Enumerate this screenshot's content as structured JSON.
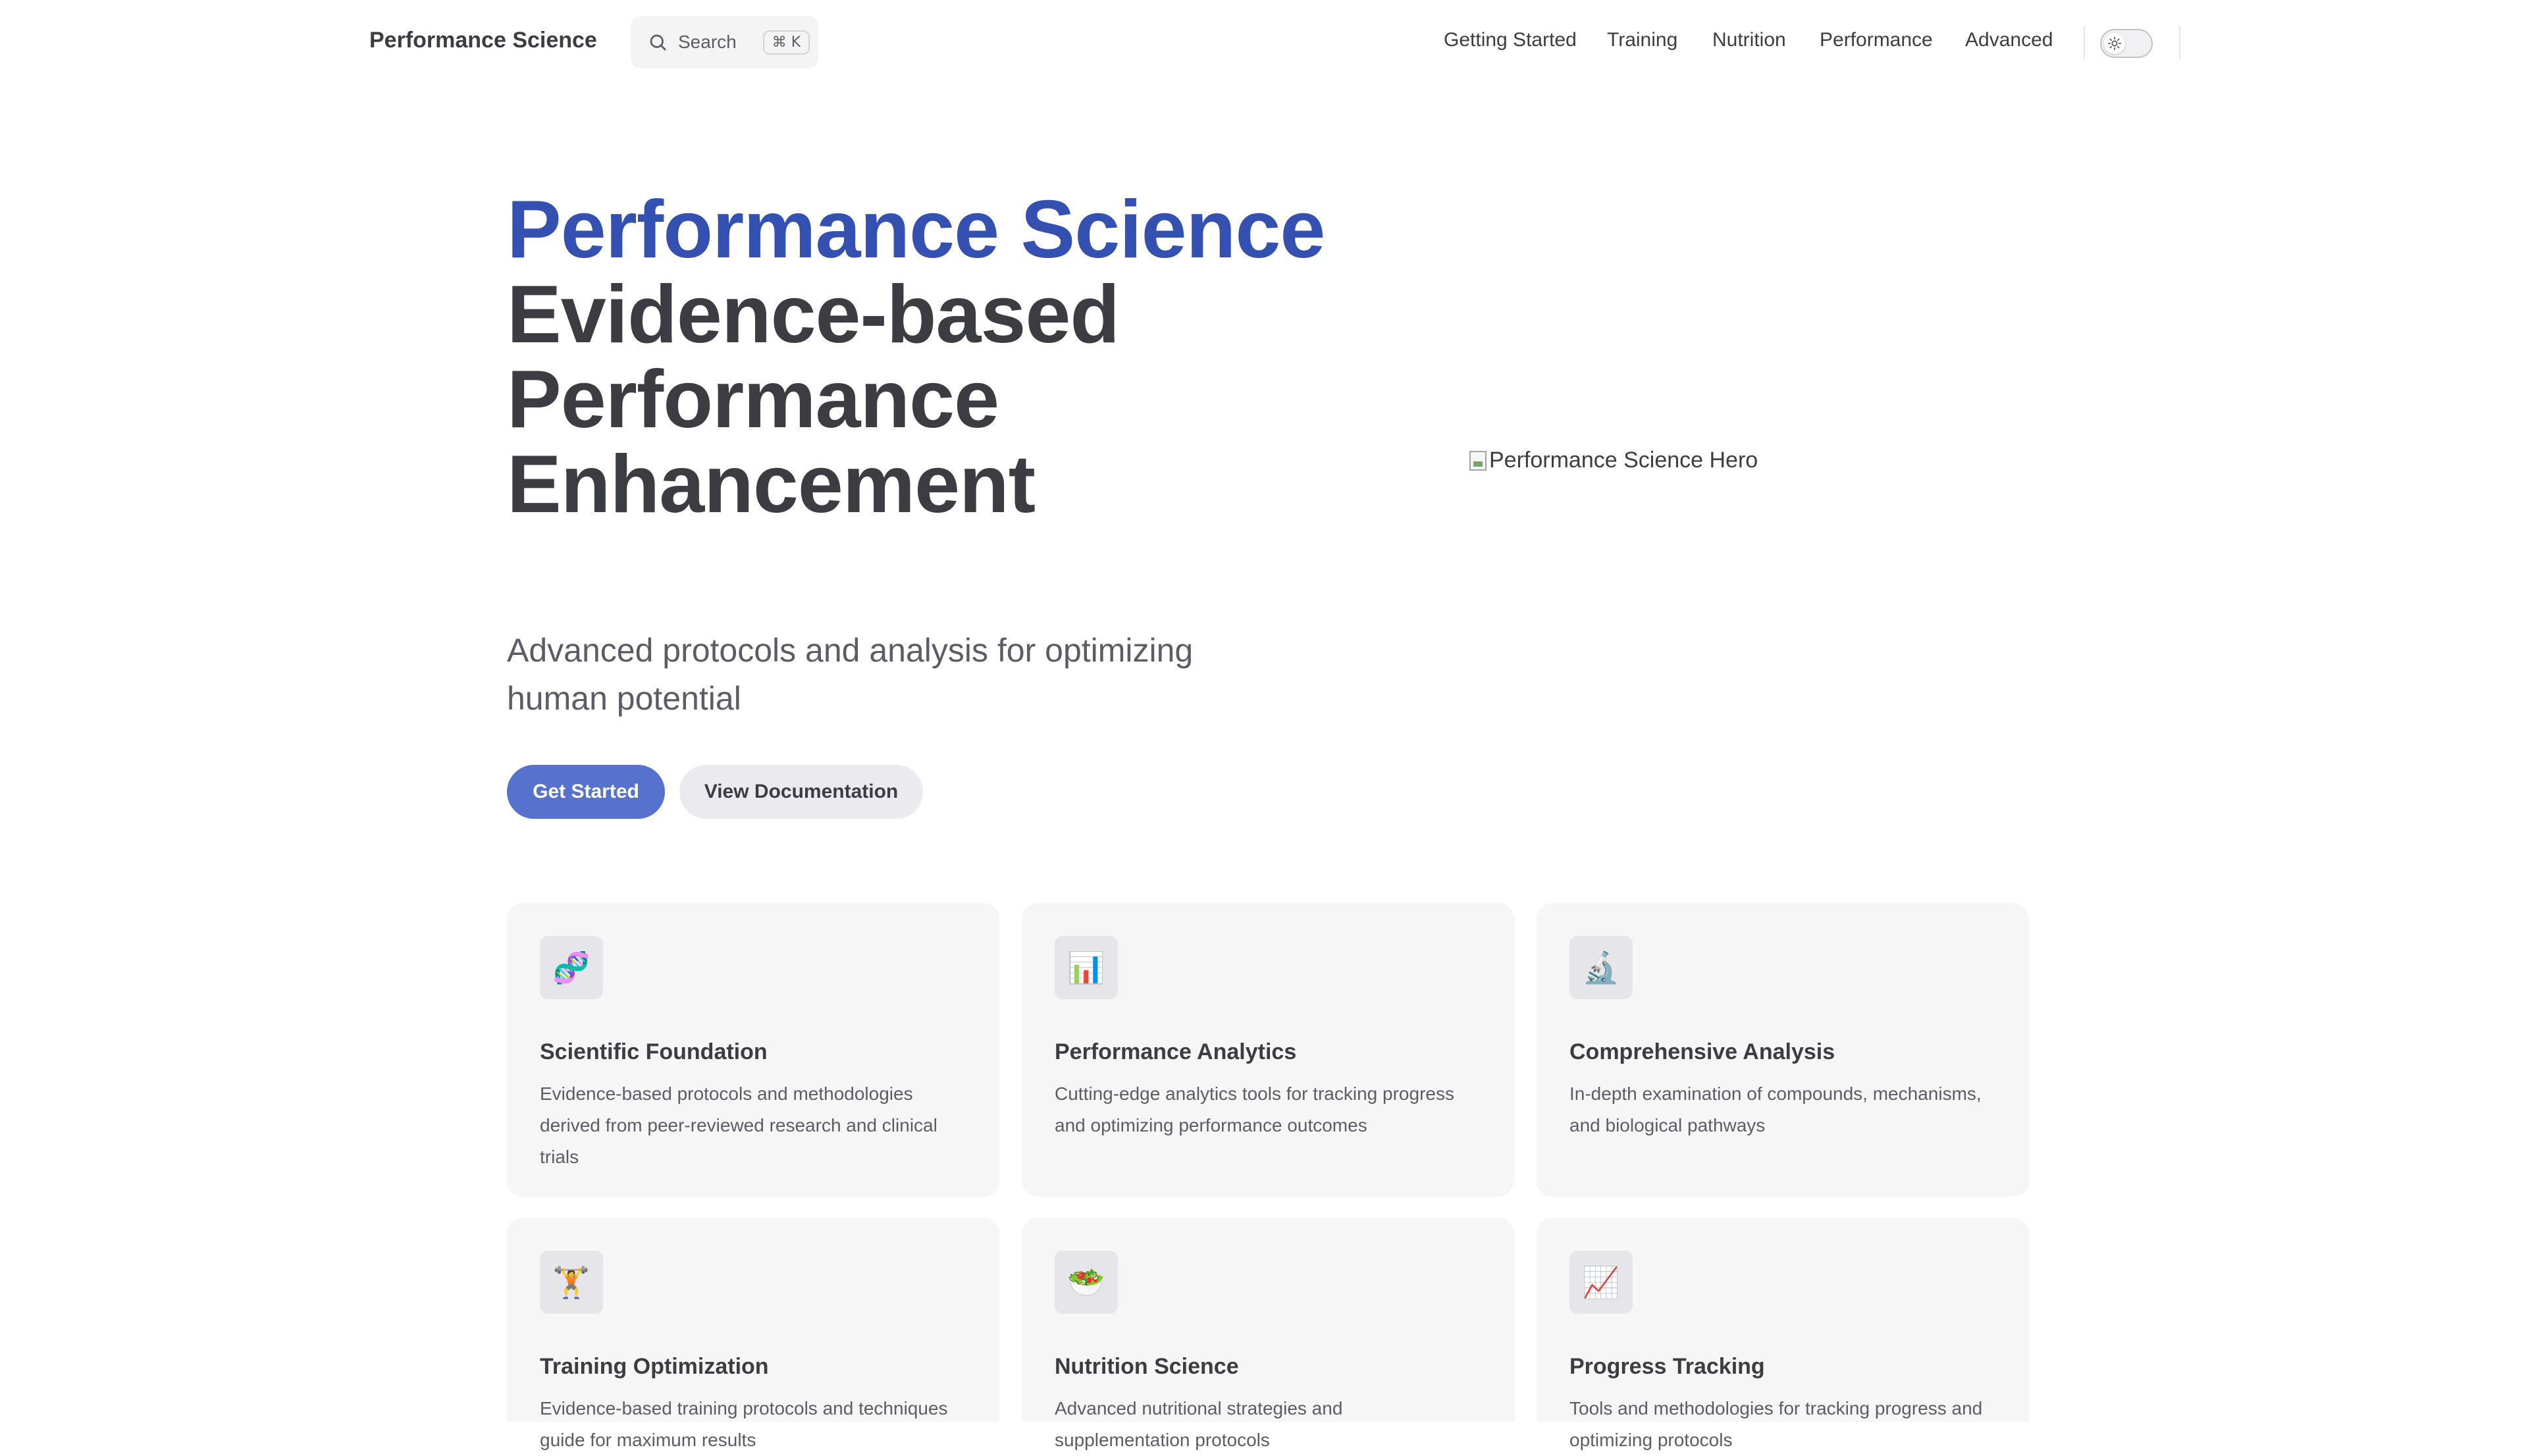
{
  "nav": {
    "brand": "Performance Science",
    "search": {
      "label": "Search",
      "shortcut": "⌘ K"
    },
    "links": [
      "Getting Started",
      "Training",
      "Nutrition",
      "Performance",
      "Advanced"
    ],
    "theme_toggle_icon": "sun-icon"
  },
  "hero": {
    "name": "Performance Science",
    "text": "Evidence-based Performance Enhancement",
    "tagline": "Advanced protocols and analysis for optimizing human potential",
    "actions": {
      "primary": "Get Started",
      "secondary": "View Documentation"
    },
    "image_alt": "Performance Science Hero"
  },
  "features": [
    {
      "icon": "🧬",
      "icon_name": "dna-icon",
      "title": "Scientific Foundation",
      "details": "Evidence-based protocols and methodologies derived from peer-reviewed research and clinical trials"
    },
    {
      "icon": "📊",
      "icon_name": "bar-chart-icon",
      "title": "Performance Analytics",
      "details": "Cutting-edge analytics tools for tracking progress and optimizing performance outcomes"
    },
    {
      "icon": "🔬",
      "icon_name": "microscope-icon",
      "title": "Comprehensive Analysis",
      "details": "In-depth examination of compounds, mechanisms, and biological pathways"
    },
    {
      "icon": "🏋",
      "icon_name": "weight-lifter-icon",
      "title": "Training Optimization",
      "details": "Evidence-based training protocols and techniques guide for maximum results"
    },
    {
      "icon": "🥗",
      "icon_name": "salad-icon",
      "title": "Nutrition Science",
      "details": "Advanced nutritional strategies and supplementation protocols"
    },
    {
      "icon": "📈",
      "icon_name": "chart-increasing-icon",
      "title": "Progress Tracking",
      "details": "Tools and methodologies for tracking progress and optimizing protocols"
    }
  ],
  "colors": {
    "brand": "#3451b2",
    "button": "#5672cd",
    "card_bg": "#f6f6f7"
  }
}
